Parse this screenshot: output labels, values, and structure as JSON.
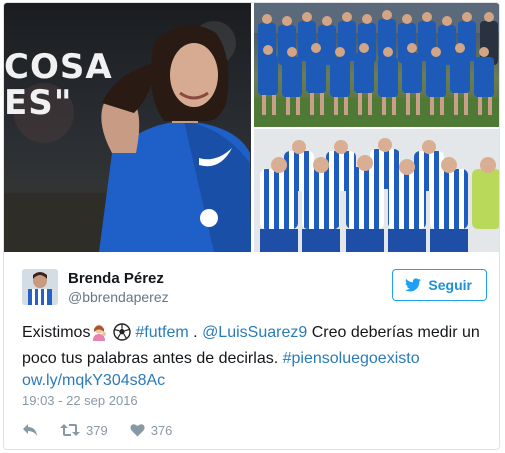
{
  "media": {
    "overlay_lines": [
      "COSA",
      "ES\""
    ]
  },
  "tweet": {
    "author_name": "Brenda Pérez",
    "author_handle": "@bbrendaperez",
    "follow_label": "Seguir",
    "text": {
      "prefix": "Existimos",
      "hashtag1": "#futfem",
      "dot": " .",
      "mention": "@LuisSuarez9",
      "body": " Creo deberías medir un poco tus palabras antes de decirlas. ",
      "hashtag2": "#piensoluegoexisto",
      "url": "ow.ly/mqkY304s8Ac"
    },
    "timestamp": "19:03 - 22 sep 2016",
    "retweet_count": "379",
    "like_count": "376"
  },
  "icons": {
    "reply": "reply-icon",
    "retweet": "retweet-icon",
    "like": "heart-icon",
    "bird": "twitter-bird-icon",
    "woman_emoji": "woman-gesturing-emoji",
    "ball_emoji": "soccer-ball-emoji"
  },
  "colors": {
    "link": "#2b7bb9",
    "follow": "#1da1f2",
    "muted": "#8899a6"
  }
}
